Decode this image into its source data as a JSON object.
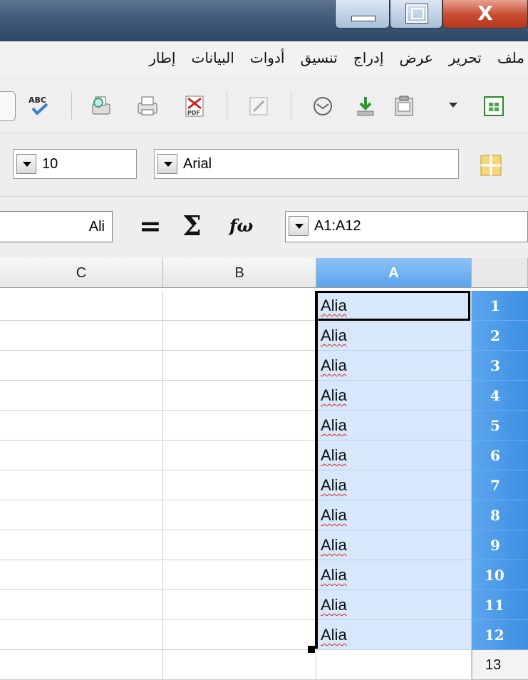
{
  "window": {
    "buttons": {
      "minimize": "minimize",
      "maximize": "maximize",
      "close": "X"
    }
  },
  "menu": {
    "items": [
      "ملف",
      "تحرير",
      "عرض",
      "إدراج",
      "تنسيق",
      "أدوات",
      "البيانات",
      "إطار"
    ]
  },
  "toolbar": {
    "icons": [
      "spellcheck-icon",
      "print-preview-icon",
      "print-icon",
      "export-pdf-icon",
      "edit-file-icon",
      "email-icon",
      "download-icon",
      "paste-icon",
      "spreadsheet-icon"
    ],
    "spellcheck_label": "ABC"
  },
  "formatting": {
    "font_size": "10",
    "font_name": "Arial"
  },
  "formula_bar": {
    "name_box": "Ali",
    "equals_symbol": "=",
    "sum_symbol": "Σ",
    "function_symbol": "f(x)",
    "function_display": "fω",
    "formula_value": "A1:A12"
  },
  "grid": {
    "columns": [
      "C",
      "B",
      "A"
    ],
    "selected_column": "A",
    "rows": [
      {
        "num": "1",
        "a": "Alia"
      },
      {
        "num": "2",
        "a": "Alia"
      },
      {
        "num": "3",
        "a": "Alia"
      },
      {
        "num": "4",
        "a": "Alia"
      },
      {
        "num": "5",
        "a": "Alia"
      },
      {
        "num": "6",
        "a": "Alia"
      },
      {
        "num": "7",
        "a": "Alia"
      },
      {
        "num": "8",
        "a": "Alia"
      },
      {
        "num": "9",
        "a": "Alia"
      },
      {
        "num": "10",
        "a": "Alia"
      },
      {
        "num": "11",
        "a": "Alia"
      },
      {
        "num": "12",
        "a": "Alia"
      },
      {
        "num": "13",
        "a": ""
      }
    ]
  },
  "colors": {
    "selection": "#d6e8fa",
    "row_header_selected": "#4a9ae8",
    "column_header_selected": "#6eb0f0"
  }
}
